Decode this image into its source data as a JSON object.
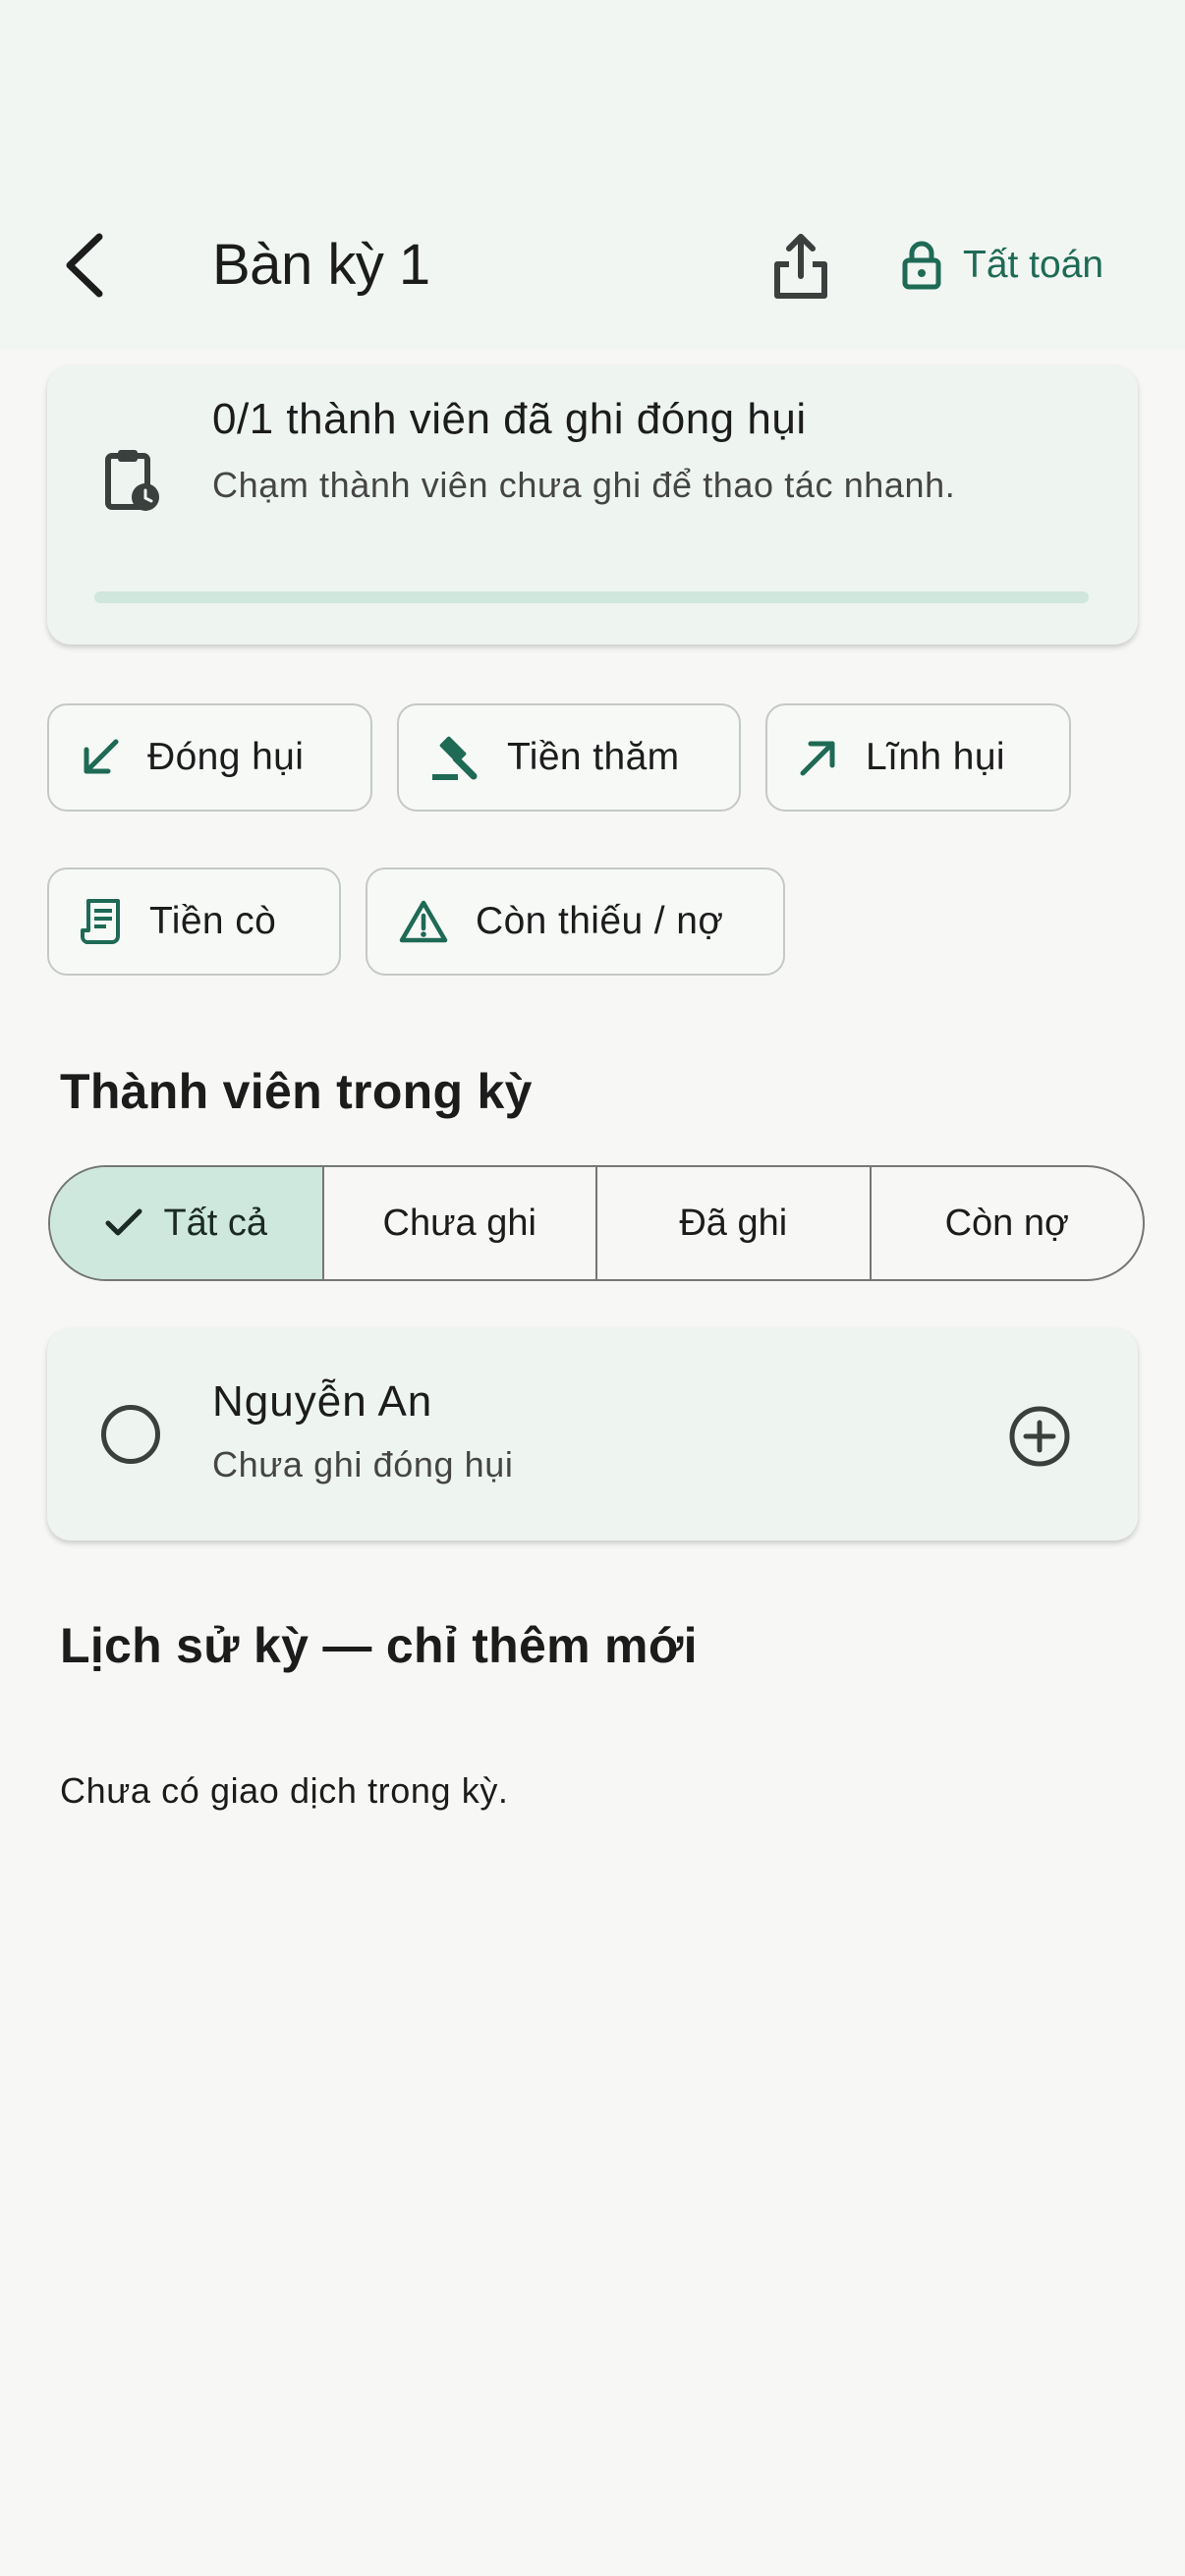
{
  "header": {
    "title": "Bàn kỳ 1",
    "settle_label": "Tất toán"
  },
  "progress": {
    "title": "0/1 thành viên đã ghi đóng hụi",
    "subtitle": "Chạm thành viên chưa ghi để thao tác nhanh.",
    "value": 0
  },
  "actions": [
    {
      "label": "Đóng hụi",
      "icon": "arrow-down-left-icon"
    },
    {
      "label": "Tiền thăm",
      "icon": "gavel-icon"
    },
    {
      "label": "Lĩnh hụi",
      "icon": "arrow-up-right-icon"
    },
    {
      "label": "Tiền cò",
      "icon": "receipt-icon"
    },
    {
      "label": "Còn thiếu / nợ",
      "icon": "warning-icon"
    }
  ],
  "members_section": {
    "title": "Thành viên trong kỳ",
    "filters": [
      "Tất cả",
      "Chưa ghi",
      "Đã ghi",
      "Còn nợ"
    ],
    "selected_filter": "Tất cả"
  },
  "members": [
    {
      "name": "Nguyễn An",
      "status": "Chưa ghi đóng hụi"
    }
  ],
  "history": {
    "title": "Lịch sử kỳ — chỉ thêm mới",
    "empty_text": "Chưa có giao dịch trong kỳ."
  },
  "colors": {
    "accent": "#1e6a55",
    "selected_segment": "#cee8dd",
    "progress_track": "#cfe7dc"
  }
}
